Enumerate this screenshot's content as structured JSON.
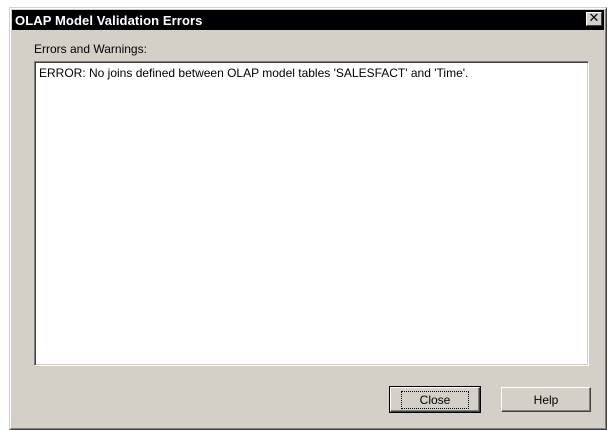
{
  "window": {
    "title": "OLAP Model Validation Errors",
    "close_glyph": "✕"
  },
  "main": {
    "group_label": "Errors and Warnings:",
    "messages": [
      "ERROR: No joins defined between OLAP model tables 'SALESFACT' and 'Time'."
    ]
  },
  "buttons": {
    "close_label": "Close",
    "help_label": "Help"
  }
}
